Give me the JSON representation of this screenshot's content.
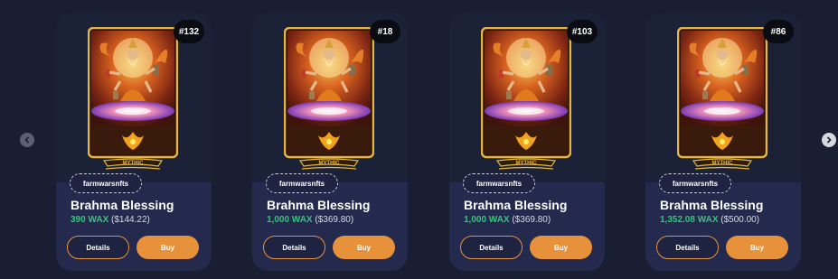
{
  "colors": {
    "page_bg": "#1a1e33",
    "card_bg": "#1d2340",
    "accent_orange": "#e8913b",
    "wax_green": "#35c47a",
    "card_frame_gold": "#e6b640"
  },
  "carousel": {
    "prev_icon": "chevron-left-icon",
    "next_icon": "chevron-right-icon"
  },
  "cards": [
    {
      "badge": "#132",
      "rarity": "MYTHIC",
      "collection": "farmwarsnfts",
      "name": "Brahma Blessing",
      "price_wax": "390 WAX",
      "price_usd": "($144.22)",
      "details_label": "Details",
      "buy_label": "Buy"
    },
    {
      "badge": "#18",
      "rarity": "MYTHIC",
      "collection": "farmwarsnfts",
      "name": "Brahma Blessing",
      "price_wax": "1,000 WAX",
      "price_usd": "($369.80)",
      "details_label": "Details",
      "buy_label": "Buy"
    },
    {
      "badge": "#103",
      "rarity": "MYTHIC",
      "collection": "farmwarsnfts",
      "name": "Brahma Blessing",
      "price_wax": "1,000 WAX",
      "price_usd": "($369.80)",
      "details_label": "Details",
      "buy_label": "Buy"
    },
    {
      "badge": "#86",
      "rarity": "MYTHIC",
      "collection": "farmwarsnfts",
      "name": "Brahma Blessing",
      "price_wax": "1,352.08 WAX",
      "price_usd": "($500.00)",
      "details_label": "Details",
      "buy_label": "Buy"
    }
  ]
}
